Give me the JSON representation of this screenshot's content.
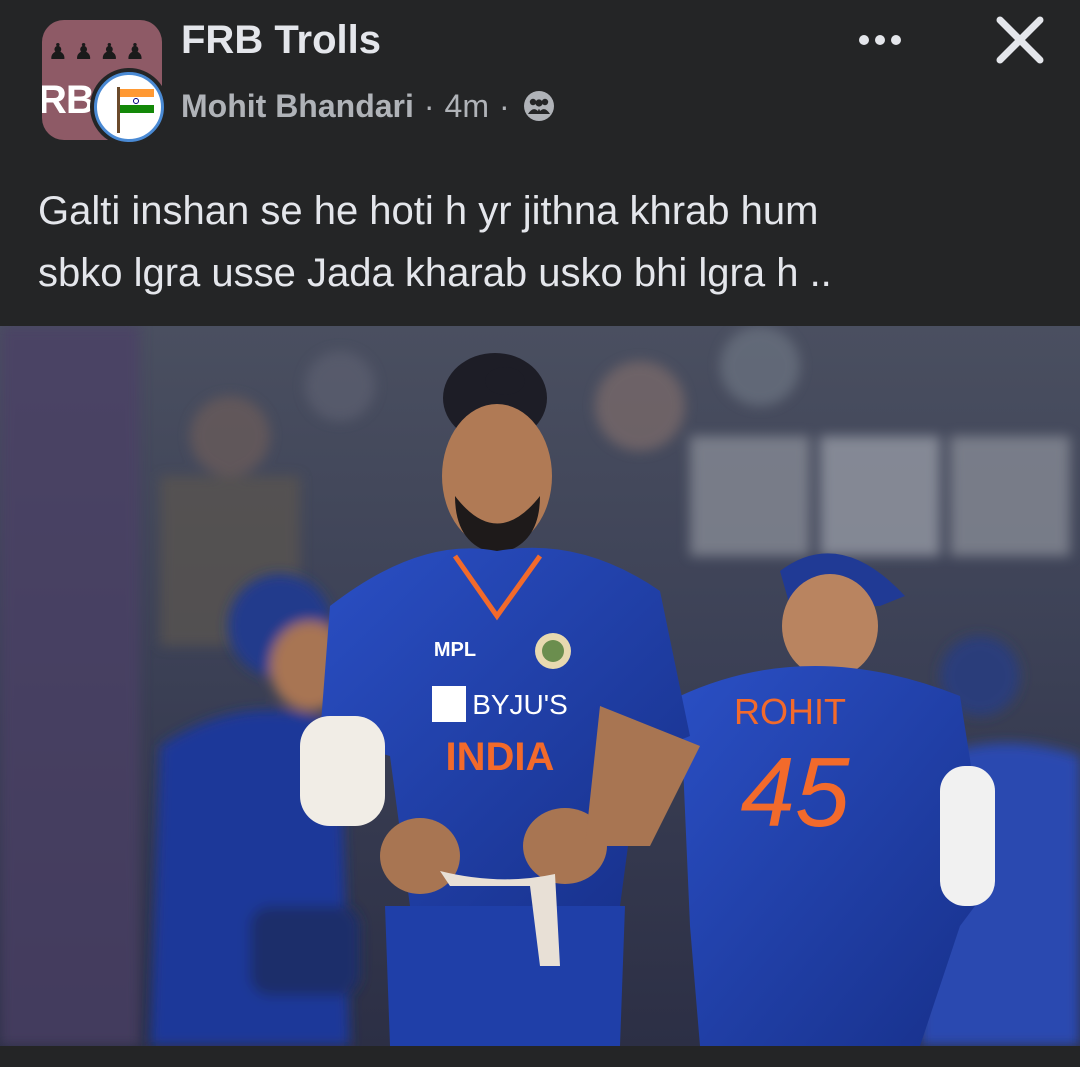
{
  "post": {
    "group_name": "FRB Trolls",
    "group_avatar_text": "RB",
    "author_name": "Mohit Bhandari",
    "separator": "·",
    "time": "4m",
    "privacy_icon": "group-members-icon",
    "more_icon": "more-options-icon",
    "close_icon": "close-icon",
    "text_line_1": "Galti inshan se he hoti h yr jithna khrab hum",
    "text_line_2": "sbko lgra usse Jada kharab usko bhi lgra h .."
  },
  "photo": {
    "jersey_sponsor": "MPL",
    "jersey_brand": "BYJU'S",
    "jersey_country": "INDIA",
    "player_name": "ROHIT",
    "player_number": "45"
  },
  "colors": {
    "background": "#242526",
    "primary_text": "#e4e6eb",
    "secondary_text": "#b0b3b8",
    "jersey_blue": "#1f3fa8",
    "jersey_orange": "#f26a2b"
  }
}
